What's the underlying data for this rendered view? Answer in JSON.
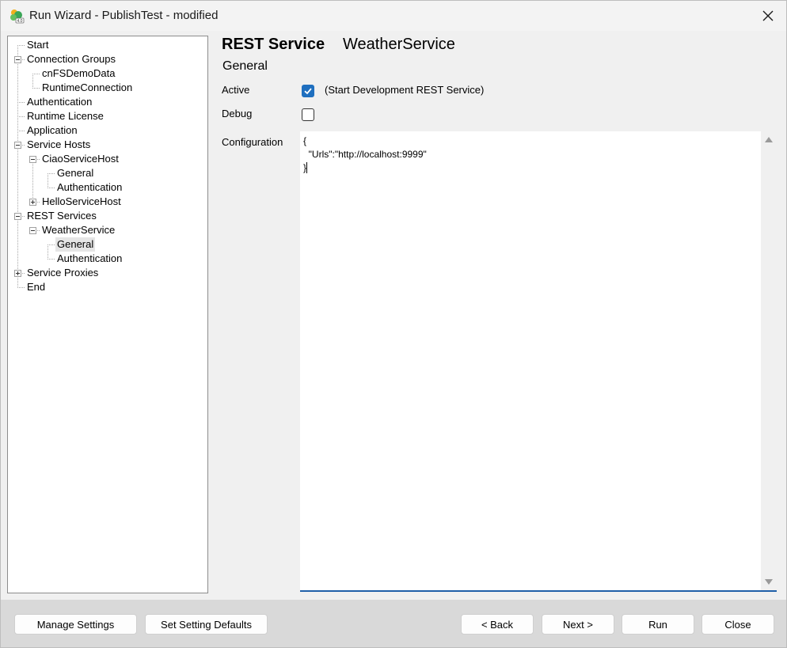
{
  "window": {
    "title": "Run Wizard - PublishTest - modified"
  },
  "icons": {
    "app": "publish-app-icon",
    "close": "close-icon"
  },
  "tree": {
    "items": [
      {
        "label": "Start"
      },
      {
        "label": "Connection Groups",
        "expander": "minus"
      },
      {
        "label": "cnFSDemoData"
      },
      {
        "label": "RuntimeConnection"
      },
      {
        "label": "Authentication"
      },
      {
        "label": "Runtime License"
      },
      {
        "label": "Application"
      },
      {
        "label": "Service Hosts",
        "expander": "minus"
      },
      {
        "label": "CiaoServiceHost",
        "expander": "minus"
      },
      {
        "label": "General"
      },
      {
        "label": "Authentication"
      },
      {
        "label": "HelloServiceHost",
        "expander": "plus"
      },
      {
        "label": "REST Services",
        "expander": "minus"
      },
      {
        "label": "WeatherService",
        "expander": "minus"
      },
      {
        "label": "General",
        "selected": true
      },
      {
        "label": "Authentication"
      },
      {
        "label": "Service Proxies",
        "expander": "plus"
      },
      {
        "label": "End"
      }
    ]
  },
  "panel": {
    "heading": "REST Service",
    "service_name": "WeatherService",
    "section": "General",
    "active_label": "Active",
    "active_checked": true,
    "active_caption": "(Start Development REST Service)",
    "debug_label": "Debug",
    "debug_checked": false,
    "config_label": "Configuration",
    "config_lines": [
      "{",
      "  \"Urls\":\"http://localhost:9999\"",
      "}"
    ]
  },
  "footer": {
    "manage_settings": "Manage Settings",
    "set_defaults": "Set Setting Defaults",
    "back": "< Back",
    "next": "Next >",
    "run": "Run",
    "close": "Close"
  },
  "colors": {
    "accent": "#1f6fbf",
    "footer_bg": "#d9d9d9"
  }
}
